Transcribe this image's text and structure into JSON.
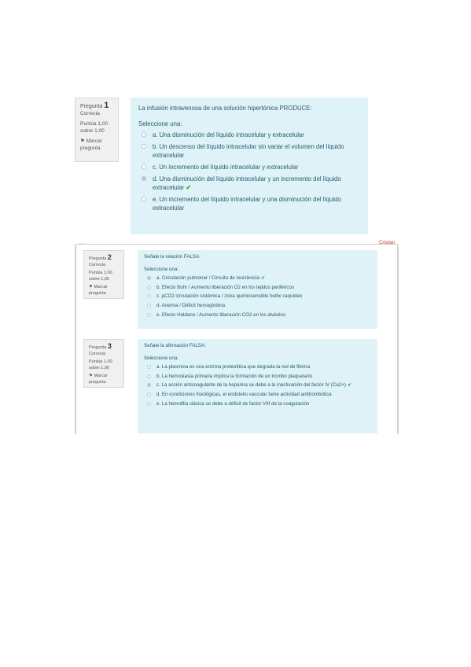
{
  "q1": {
    "label": "Pregunta",
    "number": "1",
    "status": "Correcta",
    "score": "Puntúa 1,00 sobre 1,00",
    "flag": "Marcar pregunta",
    "prompt": "La infusión intravenosa de una solución hipertónica PRODUCE:",
    "select_one": "Seleccione una:",
    "options": [
      {
        "text": "a. Una disminución del líquido intracelular y extracelular",
        "selected": false,
        "correct": false
      },
      {
        "text": "b. Un descenso del líquido intracelular sin variar el volumen del líquido extracelular",
        "selected": false,
        "correct": false
      },
      {
        "text": "c. Un incremento del líquido intracelular y extracelular",
        "selected": false,
        "correct": false
      },
      {
        "text": "d. Una disminución del líquido intracelular y un incremento del líquido extracelular",
        "selected": true,
        "correct": true
      },
      {
        "text": "e. Un incremento del líquido intracelular y una disminución del líquido extracelular",
        "selected": false,
        "correct": false
      }
    ]
  },
  "header": {
    "corner_text": "Cristian",
    "tiny_label": "....."
  },
  "q2": {
    "label": "Pregunta",
    "number": "2",
    "status": "Correcta",
    "score": "Puntúa 1,00 sobre 1,00",
    "flag": "Marcar pregunta",
    "prompt": "Señale la relación FALSA:",
    "select_one": "Seleccione una:",
    "options": [
      {
        "text": "a. Circulación pulmonar / Circuito de resistencia",
        "selected": true,
        "correct": true
      },
      {
        "text": "b. Efecto Bohr / Aumento liberación O2 en los tejidos periféricos",
        "selected": false,
        "correct": false
      },
      {
        "text": "c. pCO2 circulación sistémica / zona quimiosensible bulbo raquídeo",
        "selected": false,
        "correct": false
      },
      {
        "text": "d. Anemia / Déficit hemoglobina",
        "selected": false,
        "correct": false
      },
      {
        "text": "e. Efecto Haldane / Aumento liberación CO2 en los alvéolos",
        "selected": false,
        "correct": false
      }
    ]
  },
  "q3": {
    "label": "Pregunta",
    "number": "3",
    "status": "Correcta",
    "score": "Puntúa 1,00 sobre 1,00",
    "flag": "Marcar pregunta",
    "prompt": "Señale la afirmación FALSA:",
    "select_one": "Seleccione una:",
    "options": [
      {
        "text": "a. La plasmina es una enzima proteolítica que degrada la red de fibrina",
        "selected": false,
        "correct": false
      },
      {
        "text": "b. La hemostasia primaria implica la formación de un trombo plaquetario",
        "selected": false,
        "correct": false
      },
      {
        "text": "c. La acción anticoagulante de la heparina se debe a la inactivación del factor IV (Ca2+)",
        "selected": true,
        "correct": true
      },
      {
        "text": "d. En condiciones fisiológicas, el endotelio vascular tiene actividad antitrombótica",
        "selected": false,
        "correct": false
      },
      {
        "text": "e. La hemofilia clásica se debe a déficit de factor VIII de la coagulación",
        "selected": false,
        "correct": false
      }
    ]
  },
  "check_symbol": "✔"
}
